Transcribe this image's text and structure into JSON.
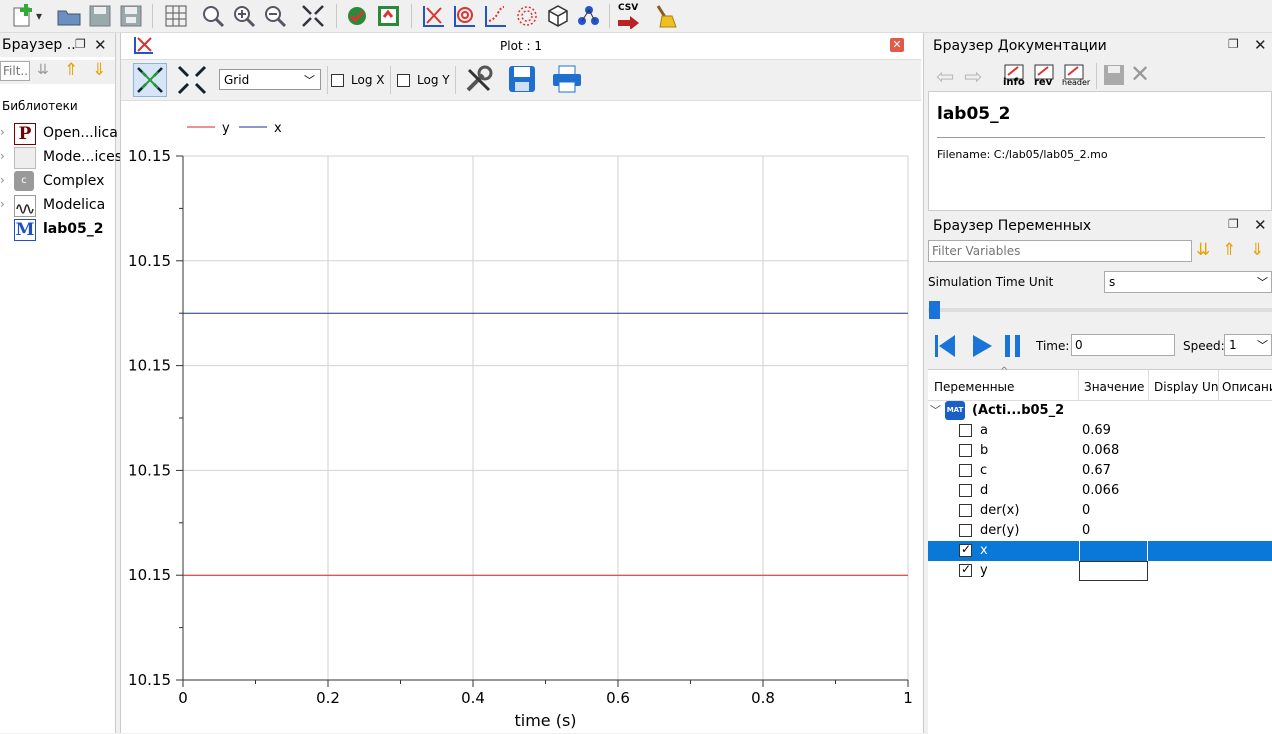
{
  "toolbar": {
    "icons": [
      "new-icon",
      "open-icon",
      "save-icon",
      "save-all-icon",
      "grid-icon",
      "zoom-icon",
      "zoom-in-icon",
      "zoom-out-icon",
      "fit-icon",
      "check-icon",
      "instantiate-icon",
      "plot-icon",
      "parametric-icon",
      "array-plot-icon",
      "array-parametric-icon",
      "3d-icon",
      "diagram-icon",
      "export-csv-icon",
      "clear-icon"
    ],
    "csv_label": "CSV"
  },
  "lib_browser": {
    "title": "Браузер ..",
    "filter_placeholder": "Filt...",
    "section": "Библиотеки",
    "items": [
      {
        "label": "Open...lica",
        "icon": "P"
      },
      {
        "label": "Mode...ices",
        "icon": ""
      },
      {
        "label": "Complex",
        "icon": "c"
      },
      {
        "label": "Modelica",
        "icon": "wave"
      },
      {
        "label": "lab05_2",
        "icon": "M"
      }
    ]
  },
  "plot": {
    "title": "Plot : 1",
    "grid_select": "Grid",
    "log_x": "Log X",
    "log_y": "Log Y",
    "legend": [
      {
        "name": "y",
        "color": "#d62728"
      },
      {
        "name": "x",
        "color": "#1f2f8f"
      }
    ]
  },
  "chart_data": {
    "type": "line",
    "xlabel": "time (s)",
    "ylabel": "",
    "xlim": [
      0,
      1
    ],
    "x_ticks": [
      "0",
      "0.2",
      "0.4",
      "0.6",
      "0.8",
      "1"
    ],
    "y_ticks": [
      "10.15",
      "10.15",
      "10.15",
      "10.15",
      "10.15",
      "10.15"
    ],
    "grid": true,
    "legend_position": "top-left",
    "series": [
      {
        "name": "x",
        "color": "#1f2f8f",
        "x": [
          0,
          1
        ],
        "y": [
          10.1505,
          10.1505
        ]
      },
      {
        "name": "y",
        "color": "#d62728",
        "x": [
          0,
          1
        ],
        "y": [
          10.15,
          10.15
        ]
      }
    ]
  },
  "doc_browser": {
    "title": "Браузер Документации",
    "buttons": [
      "info",
      "rev",
      "header"
    ],
    "model_name": "lab05_2",
    "filename": "Filename: C:/lab05/lab05_2.mo"
  },
  "var_browser": {
    "title": "Браузер Переменных",
    "filter_placeholder": "Filter Variables",
    "sim_time_unit_label": "Simulation Time Unit",
    "sim_time_unit_value": "s",
    "time_label": "Time:",
    "time_value": "0",
    "speed_label": "Speed:",
    "speed_value": "1",
    "columns": [
      "Переменные",
      "Значение",
      "Display Un",
      "Описани"
    ],
    "root": "(Acti...b05_2",
    "root_badge": "MAT",
    "rows": [
      {
        "name": "a",
        "value": "0.69",
        "checked": false
      },
      {
        "name": "b",
        "value": "0.068",
        "checked": false
      },
      {
        "name": "c",
        "value": "0.67",
        "checked": false
      },
      {
        "name": "d",
        "value": "0.066",
        "checked": false
      },
      {
        "name": "der(x)",
        "value": "0",
        "checked": false
      },
      {
        "name": "der(y)",
        "value": "0",
        "checked": false
      },
      {
        "name": "x",
        "value": "",
        "checked": true
      },
      {
        "name": "y",
        "value": "",
        "checked": true
      }
    ]
  }
}
